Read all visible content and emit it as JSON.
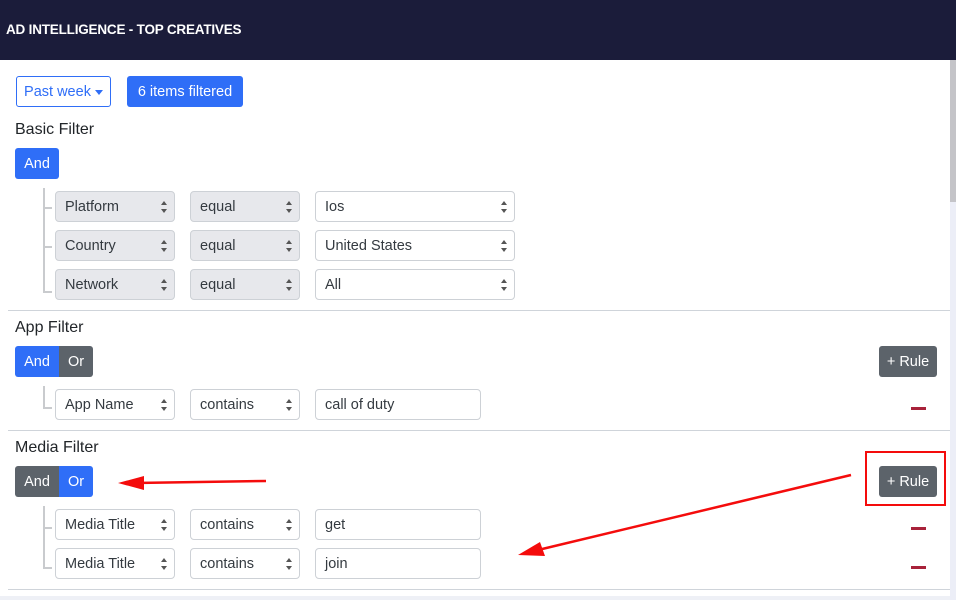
{
  "header": {
    "title": "AD INTELLIGENCE - TOP CREATIVES"
  },
  "toolbar": {
    "date_range": "Past week",
    "filter_count": "6 items filtered"
  },
  "basic_filter": {
    "title": "Basic Filter",
    "logic": {
      "and_label": "And",
      "active": "And"
    },
    "rules": [
      {
        "field": "Platform",
        "operator": "equal",
        "value": "Ios"
      },
      {
        "field": "Country",
        "operator": "equal",
        "value": "United States"
      },
      {
        "field": "Network",
        "operator": "equal",
        "value": "All"
      }
    ]
  },
  "app_filter": {
    "title": "App Filter",
    "logic": {
      "and_label": "And",
      "or_label": "Or",
      "active": "And"
    },
    "add_rule_label": "+ Rule",
    "rules": [
      {
        "field": "App Name",
        "operator": "contains",
        "value": "call of duty"
      }
    ]
  },
  "media_filter": {
    "title": "Media Filter",
    "logic": {
      "and_label": "And",
      "or_label": "Or",
      "active": "Or"
    },
    "add_rule_label": "+ Rule",
    "rules": [
      {
        "field": "Media Title",
        "operator": "contains",
        "value": "get"
      },
      {
        "field": "Media Title",
        "operator": "contains",
        "value": "join"
      }
    ]
  },
  "colors": {
    "header_bg": "#1b1c3a",
    "primary": "#2f6ef7",
    "secondary": "#5c636a",
    "danger": "#a8223a",
    "annotation": "#f40c0c"
  }
}
